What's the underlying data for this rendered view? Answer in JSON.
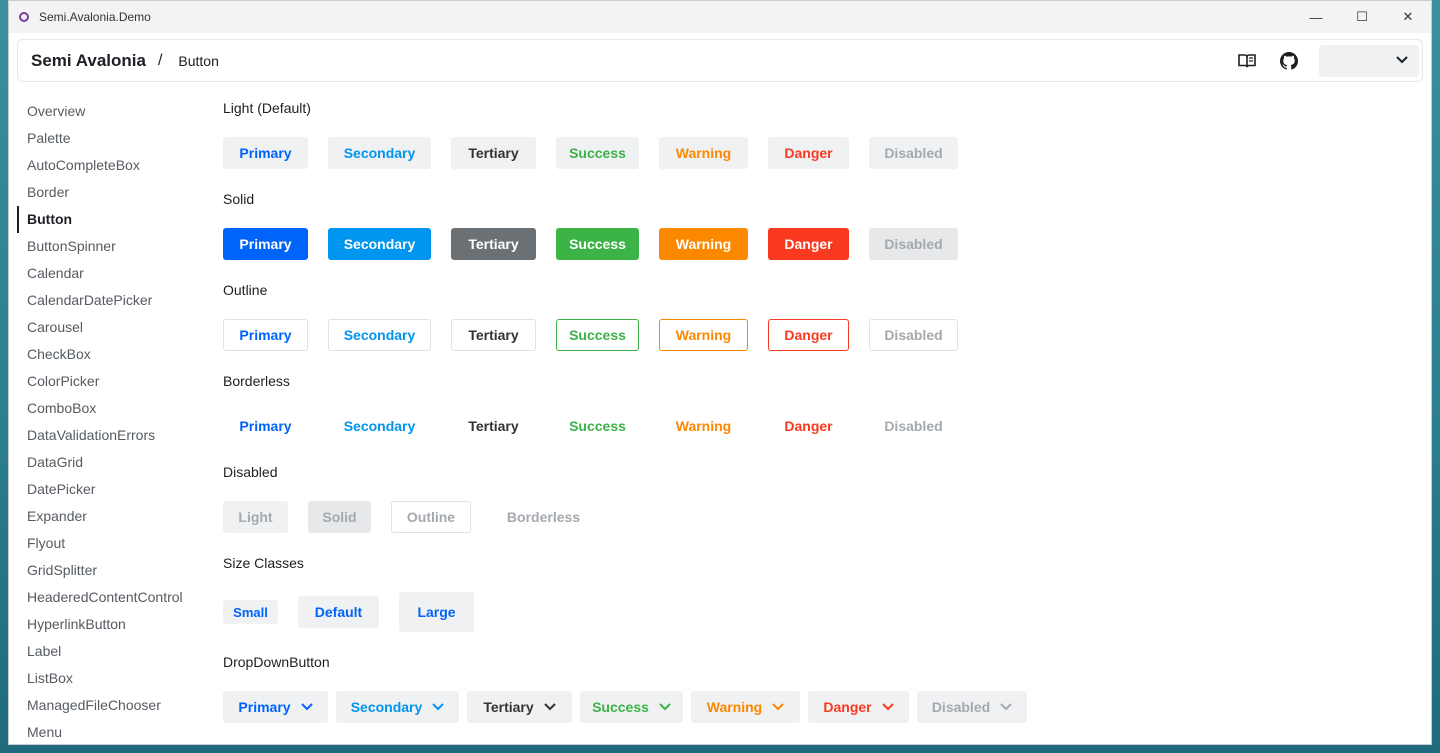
{
  "window": {
    "title": "Semi.Avalonia.Demo",
    "controls": [
      "—",
      "☐",
      "✕"
    ]
  },
  "header": {
    "brand": "Semi Avalonia",
    "separator": "/",
    "crumb": "Button",
    "theme_value": ""
  },
  "sidebar": {
    "items": [
      "Overview",
      "Palette",
      "AutoCompleteBox",
      "Border",
      "Button",
      "ButtonSpinner",
      "Calendar",
      "CalendarDatePicker",
      "Carousel",
      "CheckBox",
      "ColorPicker",
      "ComboBox",
      "DataValidationErrors",
      "DataGrid",
      "DatePicker",
      "Expander",
      "Flyout",
      "GridSplitter",
      "HeaderedContentControl",
      "HyperlinkButton",
      "Label",
      "ListBox",
      "ManagedFileChooser",
      "Menu"
    ],
    "active": "Button"
  },
  "sections": {
    "light": {
      "title": "Light (Default)"
    },
    "solid": {
      "title": "Solid"
    },
    "outline": {
      "title": "Outline"
    },
    "borderless": {
      "title": "Borderless"
    },
    "disabled": {
      "title": "Disabled",
      "buttons": [
        "Light",
        "Solid",
        "Outline",
        "Borderless"
      ]
    },
    "sizes": {
      "title": "Size Classes",
      "buttons": [
        "Small",
        "Default",
        "Large"
      ]
    },
    "dropdown": {
      "title": "DropDownButton"
    }
  },
  "variants": [
    "Primary",
    "Secondary",
    "Tertiary",
    "Success",
    "Warning",
    "Danger",
    "Disabled"
  ],
  "colors": {
    "primary": "#0064fa",
    "secondary": "#0095ee",
    "tertiary": "#6b7075",
    "success": "#3bb346",
    "warning": "#fc8800",
    "danger": "#f93920",
    "disabled": "#a4a9ae"
  }
}
